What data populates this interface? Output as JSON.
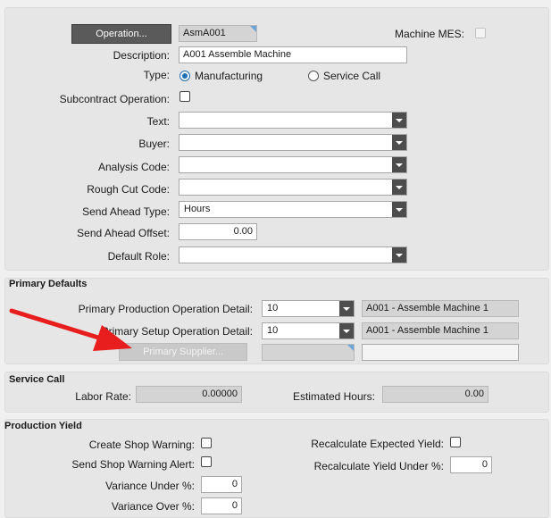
{
  "header": {
    "operation_button": "Operation...",
    "operation_code": "AsmA001",
    "machine_mes_label": "Machine MES:",
    "description_label": "Description:",
    "description_value": "A001 Assemble Machine",
    "type_label": "Type:",
    "type_options": [
      "Manufacturing",
      "Service Call"
    ],
    "type_selected": "Manufacturing",
    "subcontract_label": "Subcontract Operation:",
    "text_label": "Text:",
    "buyer_label": "Buyer:",
    "analysis_code_label": "Analysis Code:",
    "rough_cut_code_label": "Rough Cut Code:",
    "send_ahead_type_label": "Send Ahead Type:",
    "send_ahead_type_value": "Hours",
    "send_ahead_offset_label": "Send Ahead Offset:",
    "send_ahead_offset_value": "0.00",
    "default_role_label": "Default Role:"
  },
  "primary_defaults": {
    "title": "Primary Defaults",
    "production_detail_label": "Primary Production Operation Detail:",
    "production_detail_value": "10",
    "production_detail_desc": "A001 - Assemble Machine 1",
    "setup_detail_label": "Primary Setup Operation Detail:",
    "setup_detail_value": "10",
    "setup_detail_desc": "A001 - Assemble Machine 1",
    "supplier_button": "Primary Supplier..."
  },
  "service_call": {
    "title": "Service Call",
    "labor_rate_label": "Labor Rate:",
    "labor_rate_value": "0.00000",
    "estimated_hours_label": "Estimated Hours:",
    "estimated_hours_value": "0.00"
  },
  "production_yield": {
    "title": "Production Yield",
    "create_shop_warning_label": "Create Shop Warning:",
    "send_shop_warning_alert_label": "Send Shop Warning Alert:",
    "variance_under_label": "Variance Under %:",
    "variance_under_value": "0",
    "variance_over_label": "Variance Over %:",
    "variance_over_value": "0",
    "recalc_expected_yield_label": "Recalculate Expected Yield:",
    "recalc_yield_under_label": "Recalculate Yield Under %:",
    "recalc_yield_under_value": "0"
  },
  "colors": {
    "annotation_arrow": "#e81e1e",
    "radio_selected": "#1f6fb5",
    "dark_button": "#5a5a5a"
  }
}
